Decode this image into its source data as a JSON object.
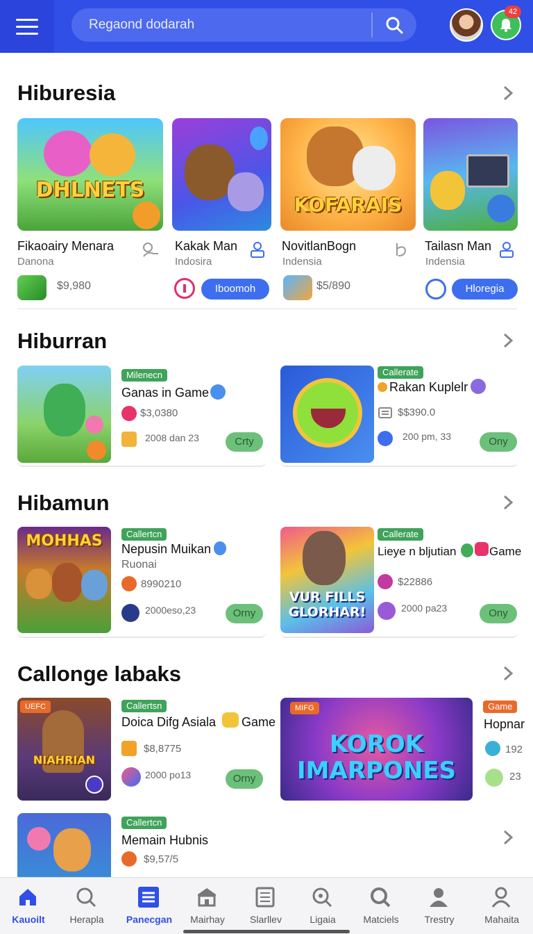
{
  "header": {
    "search_text": "Regaond dodarah",
    "notification_badge": "42"
  },
  "sections": [
    {
      "title": "Hiburesia"
    },
    {
      "title": "Hiburran"
    },
    {
      "title": "Hibamun"
    },
    {
      "title": "Callonge labaks"
    }
  ],
  "featured": [
    {
      "art_text": "DHLNETS",
      "name": "Fikaoairy Menara",
      "sub": "Danona",
      "price": "$9,980"
    },
    {
      "art_text": "",
      "name": "Kakak Man",
      "sub": "Indosira",
      "button": "Iboomoh"
    },
    {
      "art_text": "KOFARAIS",
      "name": "NovitlanBogn",
      "sub": "Indensia",
      "price": "$5/890"
    },
    {
      "art_text": "",
      "name": "Tailasn Man",
      "sub": "Indensia",
      "button": "Hloregia"
    }
  ],
  "row1": [
    {
      "tag": "Milenecn",
      "name": "Ganas  in Game",
      "price": "$3,0380",
      "date": "2008 dan 23",
      "button": "Crty"
    },
    {
      "tag": "Callerate",
      "name": "Rakan Kuplelr",
      "price": "$$390.0",
      "date": "200 pm, 33",
      "button": "Ony"
    }
  ],
  "row2": [
    {
      "tag": "Callertcn",
      "name": "Nepusin Muikan",
      "sub": "Ruonai",
      "price": "8990210",
      "date": "2000eso,23",
      "button": "Orny",
      "art_text": "MOHHAS"
    },
    {
      "tag": "Callerate",
      "name": "Lieye n bljutian",
      "name_suffix": "Game",
      "price": "$22886",
      "date": "2000 pa23",
      "button": "Ony",
      "art_text": "VUR FILLS GLORHAR!"
    }
  ],
  "row3": [
    {
      "tag": "Callertsn",
      "badge": "UEFC",
      "name": "Doica Difg Asiala",
      "name_suffix": "Game",
      "price": "$8,8775",
      "date": "2000 po13",
      "button": "Orny",
      "art_text": "NIAHRIAN"
    },
    {
      "badge": "MIFG",
      "art_text": "KOROK IMARPONES",
      "tag2": "Game",
      "name": "Hopnar",
      "meta1": "192",
      "meta2": "23"
    }
  ],
  "row4": {
    "tag": "Callertcn",
    "name": "Memain Hubnis",
    "price": "$9,57/5"
  },
  "bottom_nav": [
    {
      "label": "Kauoilt",
      "icon": "home-icon"
    },
    {
      "label": "Herapla",
      "icon": "search-icon"
    },
    {
      "label": "Panecgan",
      "icon": "list-icon"
    },
    {
      "label": "Mairhay",
      "icon": "store-icon"
    },
    {
      "label": "Slarllev",
      "icon": "document-icon"
    },
    {
      "label": "Ligaia",
      "icon": "search-icon"
    },
    {
      "label": "Matciels",
      "icon": "search-icon"
    },
    {
      "label": "Trestry",
      "icon": "person-icon"
    },
    {
      "label": "Mahaita",
      "icon": "person-icon"
    }
  ],
  "colors": {
    "primary": "#2f4fe6",
    "accent_green": "#3fa35a",
    "pill_blue": "#3d6ef0"
  }
}
